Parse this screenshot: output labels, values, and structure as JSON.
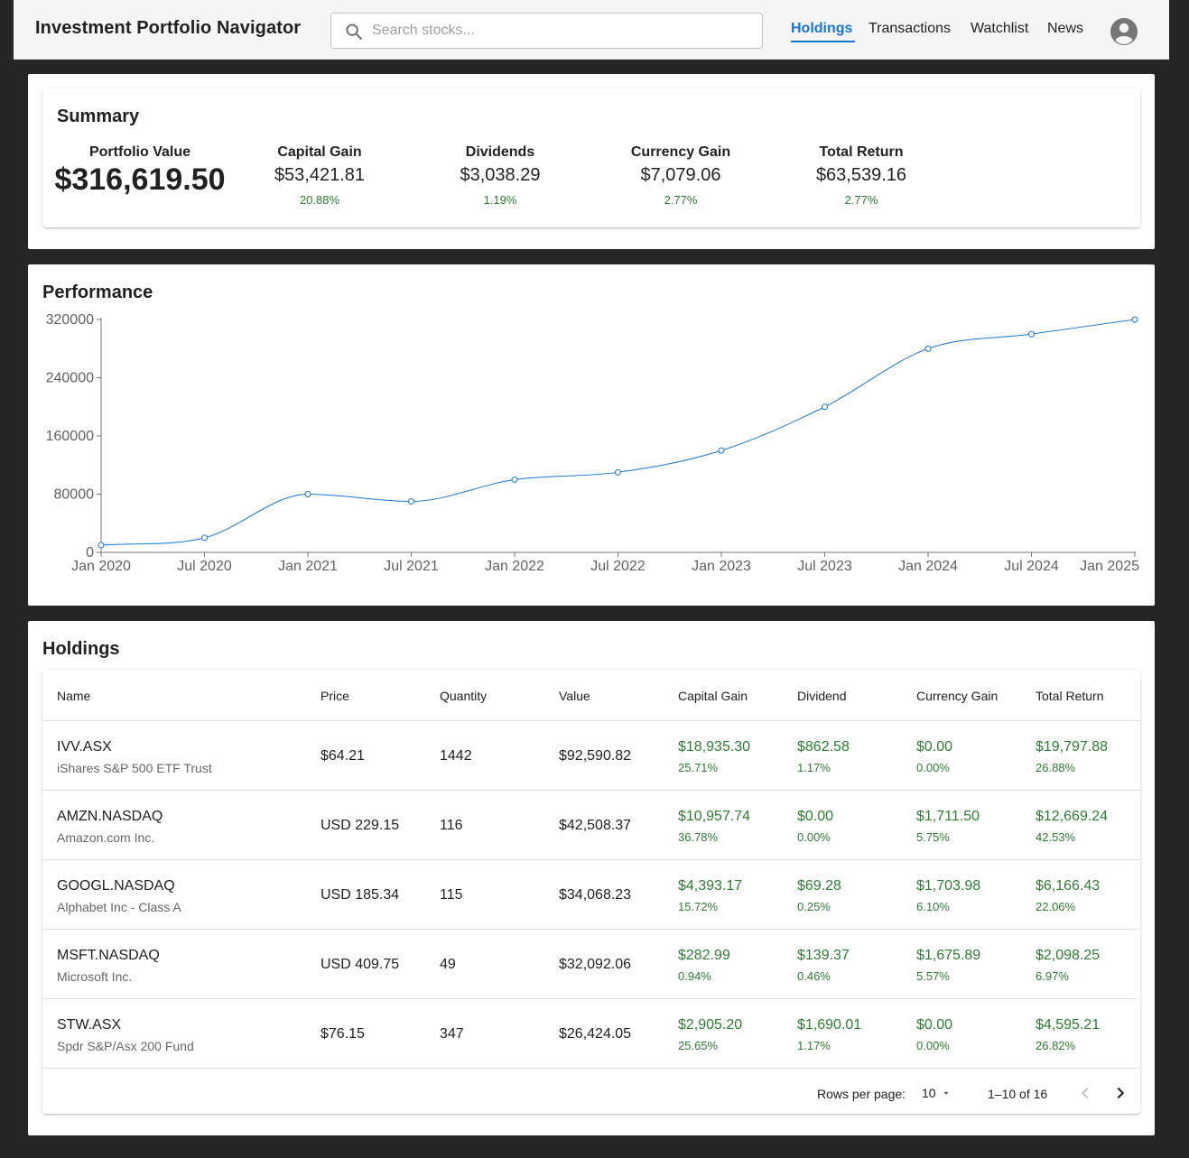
{
  "app": {
    "title": "Investment Portfolio Navigator"
  },
  "search": {
    "placeholder": "Search stocks..."
  },
  "nav": {
    "items": [
      "Holdings",
      "Transactions",
      "Watchlist",
      "News"
    ],
    "active": "Holdings"
  },
  "summary": {
    "title": "Summary",
    "portfolio_value": {
      "label": "Portfolio Value",
      "value": "$316,619.50"
    },
    "metrics": [
      {
        "label": "Capital Gain",
        "value": "$53,421.81",
        "pct": "20.88%"
      },
      {
        "label": "Dividends",
        "value": "$3,038.29",
        "pct": "1.19%"
      },
      {
        "label": "Currency Gain",
        "value": "$7,079.06",
        "pct": "2.77%"
      },
      {
        "label": "Total Return",
        "value": "$63,539.16",
        "pct": "2.77%"
      }
    ]
  },
  "performance": {
    "title": "Performance"
  },
  "chart_data": {
    "type": "line",
    "title": "",
    "x": [
      "Jan 2020",
      "Jul 2020",
      "Jan 2021",
      "Jul 2021",
      "Jan 2022",
      "Jul 2022",
      "Jan 2023",
      "Jul 2023",
      "Jan 2024",
      "Jul 2024",
      "Jan 2025"
    ],
    "values": [
      10000,
      20000,
      80000,
      70000,
      100000,
      110000,
      140000,
      200000,
      280000,
      300000,
      320000
    ],
    "ylim": [
      0,
      320000
    ],
    "yticks": [
      "0",
      "80000",
      "160000",
      "240000",
      "320000"
    ],
    "xlabel": "",
    "ylabel": "",
    "grid": false,
    "color": "#1976d2"
  },
  "holdings": {
    "title": "Holdings",
    "columns": [
      "Name",
      "Price",
      "Quantity",
      "Value",
      "Capital Gain",
      "Dividend",
      "Currency Gain",
      "Total Return"
    ],
    "rows": [
      {
        "symbol": "IVV.ASX",
        "name": "iShares S&P 500 ETF Trust",
        "price": "$64.21",
        "quantity": "1442",
        "value": "$92,590.82",
        "capital_gain": "$18,935.30",
        "capital_gain_pct": "25.71%",
        "dividend": "$862.58",
        "dividend_pct": "1.17%",
        "currency_gain": "$0.00",
        "currency_gain_pct": "0.00%",
        "total_return": "$19,797.88",
        "total_return_pct": "26.88%"
      },
      {
        "symbol": "AMZN.NASDAQ",
        "name": "Amazon.com Inc.",
        "price": "USD 229.15",
        "quantity": "116",
        "value": "$42,508.37",
        "capital_gain": "$10,957.74",
        "capital_gain_pct": "36.78%",
        "dividend": "$0.00",
        "dividend_pct": "0.00%",
        "currency_gain": "$1,711.50",
        "currency_gain_pct": "5.75%",
        "total_return": "$12,669.24",
        "total_return_pct": "42.53%"
      },
      {
        "symbol": "GOOGL.NASDAQ",
        "name": "Alphabet Inc - Class A",
        "price": "USD 185.34",
        "quantity": "115",
        "value": "$34,068.23",
        "capital_gain": "$4,393.17",
        "capital_gain_pct": "15.72%",
        "dividend": "$69.28",
        "dividend_pct": "0.25%",
        "currency_gain": "$1,703.98",
        "currency_gain_pct": "6.10%",
        "total_return": "$6,166.43",
        "total_return_pct": "22.06%"
      },
      {
        "symbol": "MSFT.NASDAQ",
        "name": "Microsoft Inc.",
        "price": "USD 409.75",
        "quantity": "49",
        "value": "$32,092.06",
        "capital_gain": "$282.99",
        "capital_gain_pct": "0.94%",
        "dividend": "$139.37",
        "dividend_pct": "0.46%",
        "currency_gain": "$1,675.89",
        "currency_gain_pct": "5.57%",
        "total_return": "$2,098.25",
        "total_return_pct": "6.97%"
      },
      {
        "symbol": "STW.ASX",
        "name": "Spdr S&P/Asx 200 Fund",
        "price": "$76.15",
        "quantity": "347",
        "value": "$26,424.05",
        "capital_gain": "$2,905.20",
        "capital_gain_pct": "25.65%",
        "dividend": "$1,690.01",
        "dividend_pct": "1.17%",
        "currency_gain": "$0.00",
        "currency_gain_pct": "0.00%",
        "total_return": "$4,595.21",
        "total_return_pct": "26.82%"
      }
    ],
    "pagination": {
      "rows_per_page_label": "Rows per page:",
      "rows_per_page": "10",
      "range": "1–10 of 16"
    }
  },
  "icons": {
    "search": "search-icon",
    "avatar": "account-circle-icon",
    "dropdown": "arrow-drop-down-icon",
    "prev": "chevron-left-icon",
    "next": "chevron-right-icon"
  },
  "colors": {
    "accent": "#1976d2",
    "positive": "#2e7d32",
    "background": "#262626"
  }
}
